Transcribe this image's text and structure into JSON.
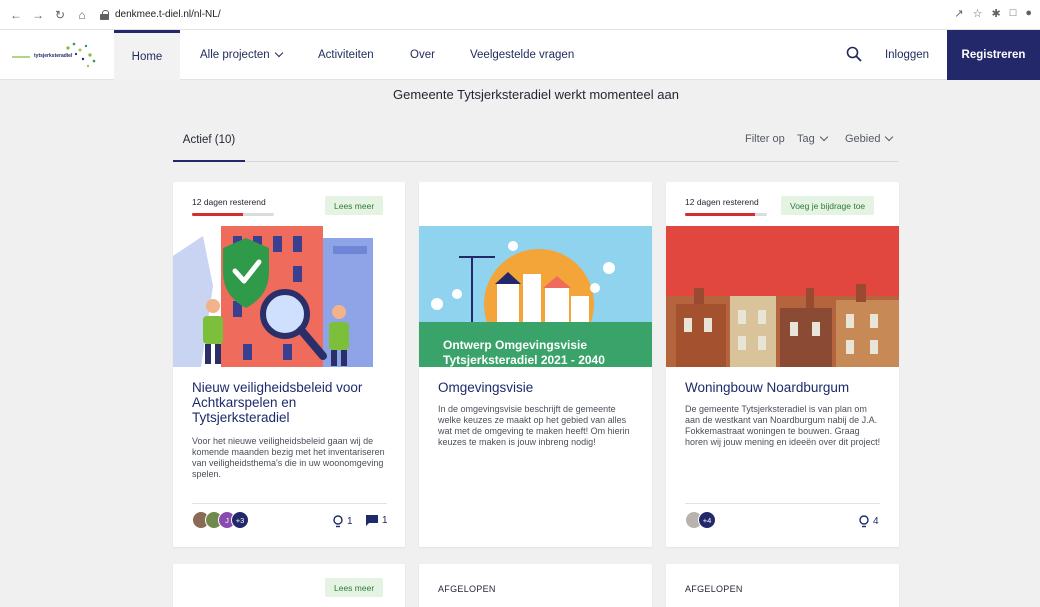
{
  "browser": {
    "url": "denkmee.t-diel.nl/nl-NL/",
    "icons": [
      "back-icon",
      "forward-icon",
      "reload-icon",
      "home-icon",
      "lock-icon",
      "share-icon",
      "star-icon",
      "extensions-icon",
      "sidebar-icon",
      "profile-icon"
    ]
  },
  "header": {
    "logo_text": "tytsjerksteradiel",
    "nav": {
      "home": "Home",
      "projects": "Alle projecten",
      "activities": "Activiteiten",
      "about": "Over",
      "faq": "Veelgestelde vragen"
    },
    "login": "Inloggen",
    "register": "Registreren"
  },
  "headline": "Gemeente Tytsjerksteradiel werkt momenteel aan",
  "filters": {
    "active_tab": "Actief (10)",
    "filter_label": "Filter op",
    "tag": "Tag",
    "area": "Gebied"
  },
  "projects": [
    {
      "remaining": "12 dagen resterend",
      "progress": 0.62,
      "cta": "Lees meer",
      "title": "Nieuw veiligheidsbeleid voor Achtkarspelen en Tytsjerksteradiel",
      "description": "Voor het nieuwe veiligheidsbeleid gaan wij de komende maanden bezig met het inventariseren van veiligheidsthema's die in uw woonomgeving spelen.",
      "avatars": [
        "J",
        "+3"
      ],
      "ideas": "1",
      "comments": "1"
    },
    {
      "image_text": "Ontwerp Omgevingsvisie Tytsjerksteradiel 2021 - 2040",
      "title": "Omgevingsvisie",
      "description": "In de omgevingsvisie beschrijft de gemeente welke keuzes ze maakt op het gebied van alles wat met de omgeving te maken heeft! Om hierin keuzes te maken is jouw inbreng nodig!"
    },
    {
      "remaining": "12 dagen resterend",
      "progress": 0.85,
      "cta": "Voeg je bijdrage toe",
      "title": "Woningbouw Noardburgum",
      "description": "De gemeente Tytsjerksteradiel is van plan om aan de westkant van Noardburgum nabij de J.A. Fokkemastraat woningen te bouwen. Graag horen wij jouw mening en ideeën over dit project!",
      "avatars": [
        "+4"
      ],
      "ideas": "4"
    }
  ],
  "lower_cards": [
    {
      "cta": "Lees meer"
    },
    {
      "status": "AFGELOPEN"
    },
    {
      "status": "AFGELOPEN"
    }
  ],
  "colors": {
    "brand": "#23286b",
    "progress": "#d62c2c",
    "cta_bg": "#e5f3e3",
    "cta_text": "#2f7a3c"
  }
}
